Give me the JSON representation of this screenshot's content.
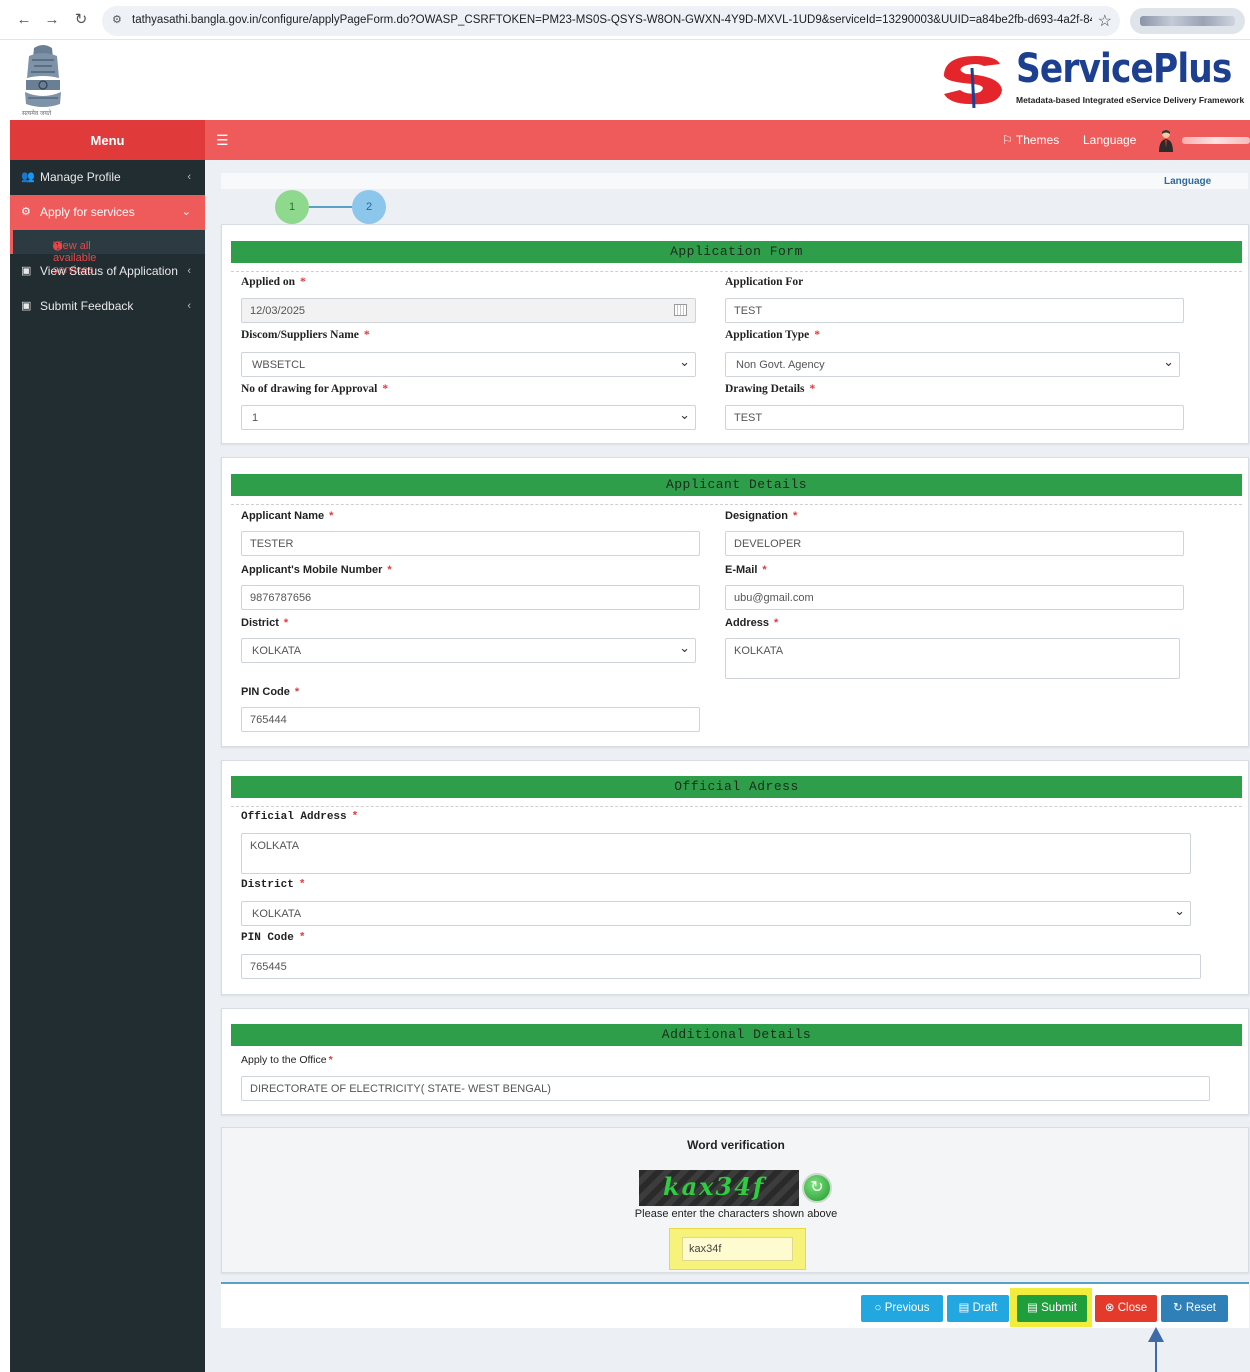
{
  "browser": {
    "url": "tathyasathi.bangla.gov.in/configure/applyPageForm.do?OWASP_CSRFTOKEN=PM23-MS0S-QSYS-W8ON-GWXN-4Y9D-MXVL-1UD9&serviceId=13290003&UUID=a84be2fb-d693-4a2f-84da-ff89..."
  },
  "header": {
    "brand": "ServicePlus",
    "tagline": "Metadata-based Integrated eService Delivery Framework",
    "emblem_caption": "सत्यमेव जयते"
  },
  "topnav": {
    "menu": "Menu",
    "themes": "Themes",
    "language": "Language"
  },
  "sidebar": {
    "manage_profile": "Manage Profile",
    "apply_services": "Apply for services",
    "view_all": "View all available services",
    "view_status": "View Status of Application",
    "feedback": "Submit Feedback"
  },
  "content": {
    "language_link": "Language",
    "steps": [
      "1",
      "2"
    ]
  },
  "application_form": {
    "title": "Application Form",
    "applied_on_label": "Applied on",
    "applied_on": "12/03/2025",
    "application_for_label": "Application For",
    "application_for": "TEST",
    "discom_label": "Discom/Suppliers Name",
    "discom": "WBSETCL",
    "app_type_label": "Application Type",
    "app_type": "Non Govt. Agency",
    "drawings_label": "No of drawing for Approval",
    "drawings": "1",
    "drawing_details_label": "Drawing Details",
    "drawing_details": "TEST"
  },
  "applicant": {
    "title": "Applicant Details",
    "name_label": "Applicant Name",
    "name": "TESTER",
    "designation_label": "Designation",
    "designation": "DEVELOPER",
    "mobile_label": "Applicant's Mobile Number",
    "mobile": "9876787656",
    "email_label": "E-Mail",
    "email": "ubu@gmail.com",
    "district_label": "District",
    "district": "KOLKATA",
    "address_label": "Address",
    "address": "KOLKATA",
    "pin_label": "PIN Code",
    "pin": "765444"
  },
  "official": {
    "title": "Official Adress",
    "address_label": "Official Address",
    "address": "KOLKATA",
    "district_label": "District",
    "district": "KOLKATA",
    "pin_label": "PIN Code",
    "pin": "765445"
  },
  "additional": {
    "title": "Additional Details",
    "office_label": "Apply to the Office",
    "office": "DIRECTORATE OF ELECTRICITY( STATE- WEST BENGAL)"
  },
  "verification": {
    "title": "Word verification",
    "captcha_text": "kax34f",
    "hint": "Please enter the characters shown above",
    "entered": "kax34f"
  },
  "buttons": {
    "previous": "Previous",
    "draft": "Draft",
    "submit": "Submit",
    "close": "Close",
    "reset": "Reset"
  },
  "colors": {
    "nav_red": "#ef5b5b",
    "section_green": "#2f9e4a",
    "sidebar_dark": "#222d32",
    "highlight_yellow": "#f2ec3c"
  }
}
